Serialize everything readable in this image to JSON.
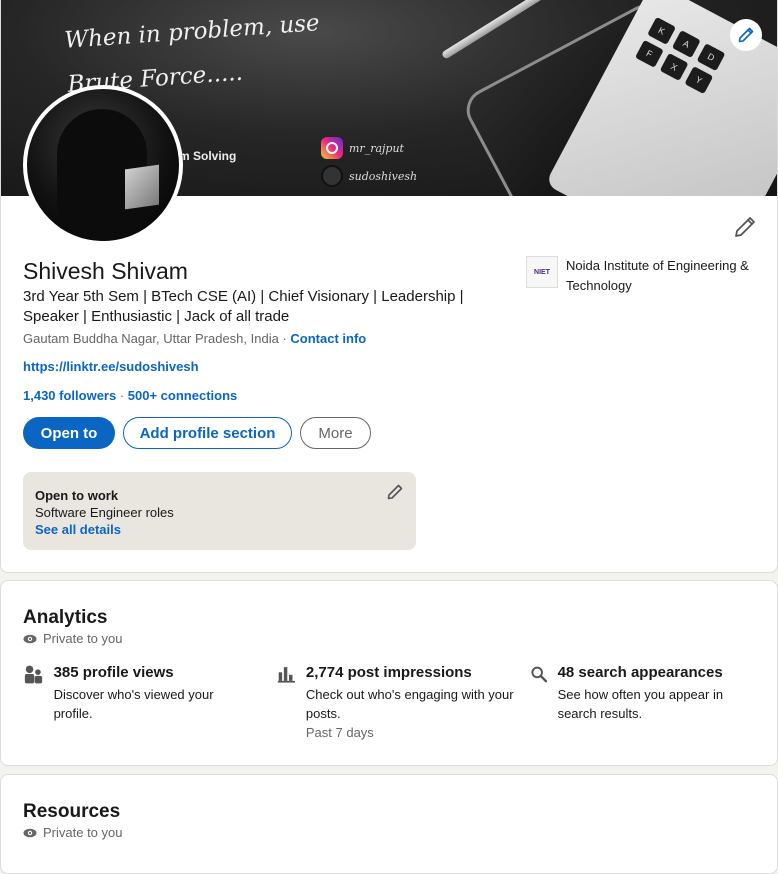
{
  "banner": {
    "quote": "When in problem, use\nBrute Force.....",
    "subtitle": "m Solving",
    "instagram_handle": "mr_rajput",
    "github_handle": "sudoshivesh",
    "laptop_keys": [
      "K",
      "A",
      "F",
      "X",
      "Y",
      "D"
    ]
  },
  "profile": {
    "name": "Shivesh Shivam",
    "headline": "3rd Year 5th Sem | BTech CSE (AI) | Chief Visionary | Leadership | Speaker | Enthusiastic | Jack of all trade",
    "location": "Gautam Buddha Nagar, Uttar Pradesh, India",
    "location_separator": " · ",
    "contact_info": "Contact info",
    "website": "https://linktr.ee/sudoshivesh",
    "followers": "1,430 followers",
    "connections_separator": " · ",
    "connections": "500+ connections",
    "school_logo_text": "NIET",
    "school": "Noida Institute of Engineering & Technology"
  },
  "actions": {
    "open_to": "Open to",
    "add_section": "Add profile section",
    "more": "More"
  },
  "open_to_work": {
    "title": "Open to work",
    "roles": "Software Engineer roles",
    "details_link": "See all details"
  },
  "analytics": {
    "title": "Analytics",
    "privacy": "Private to you",
    "metrics": [
      {
        "title": "385 profile views",
        "description": "Discover who's viewed your profile.",
        "note": "",
        "icon": "people-icon"
      },
      {
        "title": "2,774 post impressions",
        "description": "Check out who's engaging with your posts.",
        "note": "Past 7 days",
        "icon": "bar-chart-icon"
      },
      {
        "title": "48 search appearances",
        "description": "See how often you appear in search results.",
        "note": "",
        "icon": "search-icon"
      }
    ]
  },
  "resources": {
    "title": "Resources",
    "privacy": "Private to you"
  },
  "colors": {
    "brand_blue": "#0a66c2",
    "page_bg": "#f3f2ef",
    "otw_bg": "#e9e5df"
  }
}
